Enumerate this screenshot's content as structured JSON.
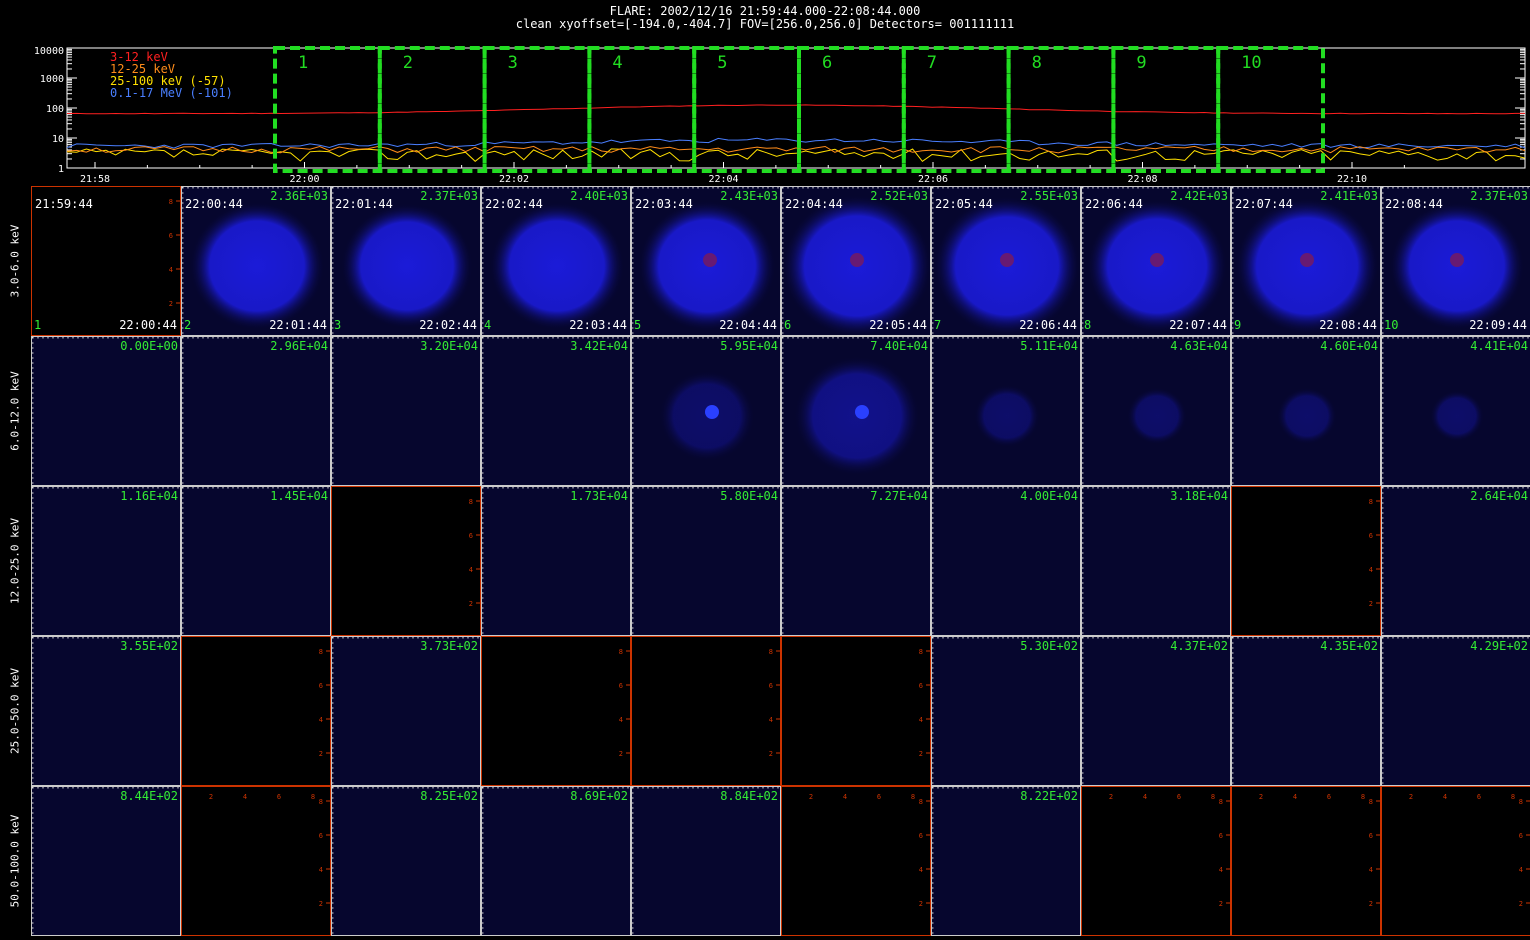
{
  "header": {
    "title": "FLARE: 2002/12/16 21:59:44.000-22:08:44.000",
    "subtitle": "clean   xyoffset=[-194.0,-404.7]   FOV=[256.0,256.0]   Detectors= 001111111"
  },
  "lightcurve": {
    "y_ticks": [
      "10000",
      "1000",
      "100",
      "10",
      "1"
    ],
    "x_ticks": [
      "21:58",
      "22:00",
      "22:02",
      "22:04",
      "22:06",
      "22:08",
      "22:10"
    ],
    "legend": [
      {
        "label": "3-12 keV",
        "color": "#ff2020"
      },
      {
        "label": "12-25 keV",
        "color": "#ff8c1a"
      },
      {
        "label": "25-100 keV (-57)",
        "color": "#ffe000"
      },
      {
        "label": "0.1-17 MeV (-101)",
        "color": "#4a7fff"
      }
    ],
    "intervals": [
      "1",
      "2",
      "3",
      "4",
      "5",
      "6",
      "7",
      "8",
      "9",
      "10"
    ],
    "interval_color": "#22dd22"
  },
  "grid": {
    "row_labels": [
      "3.0-6.0 keV",
      "6.0-12.0 keV",
      "12.0-25.0 keV",
      "25.0-50.0 keV",
      "50.0-100.0 keV"
    ],
    "start_times": [
      "21:59:44",
      "22:00:44",
      "22:01:44",
      "22:02:44",
      "22:03:44",
      "22:04:44",
      "22:05:44",
      "22:06:44",
      "22:07:44",
      "22:08:44"
    ],
    "end_times": [
      "22:00:44",
      "22:01:44",
      "22:02:44",
      "22:03:44",
      "22:04:44",
      "22:05:44",
      "22:06:44",
      "22:07:44",
      "22:08:44",
      "22:09:44"
    ],
    "indices": [
      "1",
      "2",
      "3",
      "4",
      "5",
      "6",
      "7",
      "8",
      "9",
      "10"
    ],
    "values": [
      [
        "",
        "2.36E+03",
        "2.37E+03",
        "2.40E+03",
        "2.43E+03",
        "2.52E+03",
        "2.55E+03",
        "2.42E+03",
        "2.41E+03",
        "2.37E+03"
      ],
      [
        "0.00E+00",
        "2.96E+04",
        "3.20E+04",
        "3.42E+04",
        "5.95E+04",
        "7.40E+04",
        "5.11E+04",
        "4.63E+04",
        "4.60E+04",
        "4.41E+04"
      ],
      [
        "1.16E+04",
        "1.45E+04",
        "",
        "1.73E+04",
        "5.80E+04",
        "7.27E+04",
        "4.00E+04",
        "3.18E+04",
        "",
        "2.64E+04"
      ],
      [
        "3.55E+02",
        "",
        "3.73E+02",
        "",
        "",
        "",
        "5.30E+02",
        "4.37E+02",
        "4.35E+02",
        "4.29E+02"
      ],
      [
        "8.44E+02",
        "",
        "8.25E+02",
        "8.69E+02",
        "8.84E+02",
        "",
        "8.22E+02",
        "",
        "",
        ""
      ]
    ],
    "blank": [
      [
        true,
        false,
        false,
        false,
        false,
        false,
        false,
        false,
        false,
        false
      ],
      [
        false,
        false,
        false,
        false,
        false,
        false,
        false,
        false,
        false,
        false
      ],
      [
        false,
        false,
        true,
        false,
        false,
        false,
        false,
        false,
        true,
        false
      ],
      [
        false,
        true,
        false,
        true,
        true,
        true,
        false,
        false,
        false,
        false
      ],
      [
        false,
        true,
        false,
        false,
        false,
        true,
        false,
        true,
        true,
        true
      ]
    ],
    "tick_labels": [
      "2",
      "4",
      "6",
      "8"
    ],
    "colors": {
      "value": "#33ee33",
      "border": "#cc3300",
      "image_bg": "#06062e",
      "source": "#1b1bd8"
    }
  }
}
